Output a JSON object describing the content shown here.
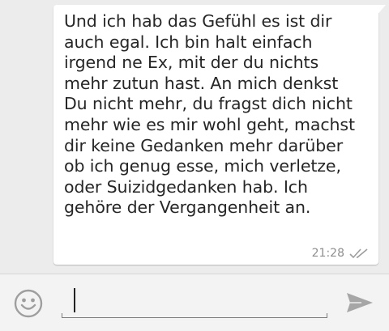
{
  "message": {
    "text": "Und ich hab das Gefühl es ist dir\nauch egal. Ich bin halt einfach\nirgend ne Ex, mit der du nichts\nmehr zutun hast. An mich denkst\nDu nicht mehr, du fragst dich nicht\nmehr wie es mir wohl geht, machst\ndir keine Gedanken mehr darüber\nob ich genug esse, mich verletze,\noder Suizidgedanken hab. Ich\ngehöre der Vergangenheit an.",
    "time": "21:28",
    "status_icon": "double-check-icon"
  },
  "composer": {
    "input_value": "",
    "emoji_icon": "smiley-icon",
    "send_icon": "send-icon"
  },
  "colors": {
    "chat_background": "#ececec",
    "bubble": "#ffffff",
    "text": "#262626",
    "meta": "#8e8e8e",
    "icon": "#9e9e9e"
  }
}
